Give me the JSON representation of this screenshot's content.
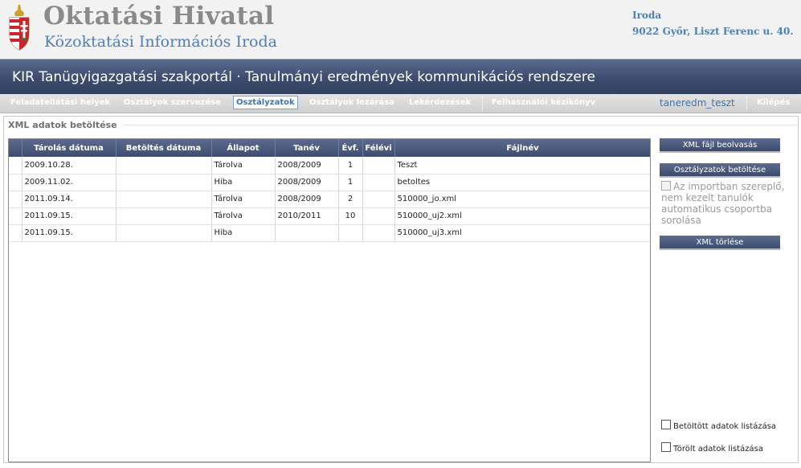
{
  "header": {
    "title": "Oktatási Hivatal",
    "subtitle": "Közoktatási Információs Iroda",
    "address_line1": "Iroda",
    "address_line2": "9022 Győr, Liszt Ferenc u. 40."
  },
  "portal": {
    "title": "KIR Tanügyigazgatási szakportál · Tanulmányi eredmények kommunikációs rendszere"
  },
  "nav": {
    "items": [
      {
        "label": "Feladatellátási helyek"
      },
      {
        "label": "Osztályok szervezése"
      },
      {
        "label": "Osztályzatok",
        "active": true
      },
      {
        "label": "Osztályok lezárása"
      },
      {
        "label": "Lekérdezések"
      },
      {
        "label": "Felhasználói kézikönyv"
      }
    ],
    "username": "taneredm_teszt",
    "logout": "Kilépés"
  },
  "panel": {
    "title": "XML adatok betöltése"
  },
  "table": {
    "columns": [
      "Tárolás dátuma",
      "Betöltés dátuma",
      "Állapot",
      "Tanév",
      "Évf.",
      "Félévi",
      "Fájlnév"
    ],
    "rows": [
      {
        "stored": "2009.10.28.",
        "loaded": "",
        "status": "Tárolva",
        "year": "2008/2009",
        "grade": "1",
        "semester": "",
        "filename": "Teszt"
      },
      {
        "stored": "2009.11.02.",
        "loaded": "",
        "status": "Hiba",
        "year": "2008/2009",
        "grade": "1",
        "semester": "",
        "filename": "betoltes"
      },
      {
        "stored": "2011.09.14.",
        "loaded": "",
        "status": "Tárolva",
        "year": "2008/2009",
        "grade": "2",
        "semester": "",
        "filename": "510000_jo.xml"
      },
      {
        "stored": "2011.09.15.",
        "loaded": "",
        "status": "Tárolva",
        "year": "2010/2011",
        "grade": "10",
        "semester": "",
        "filename": "510000_uj2.xml"
      },
      {
        "stored": "2011.09.15.",
        "loaded": "",
        "status": "Hiba",
        "year": "",
        "grade": "",
        "semester": "",
        "filename": "510000_uj3.xml"
      }
    ]
  },
  "actions": {
    "read_xml": "XML fájl beolvasás",
    "load_grades": "Osztályzatok betöltése",
    "auto_group_label": "Az importban szereplő, nem kezelt tanulók automatikus csoportba sorolása",
    "delete_xml": "XML törlése",
    "list_loaded": "Betöltött adatok listázása",
    "list_deleted": "Törölt adatok listázása"
  },
  "colors": {
    "accent_blue": "#4e7fb5",
    "bar_navy": "#3d4c6e",
    "title_gray": "#8a8a8a"
  }
}
